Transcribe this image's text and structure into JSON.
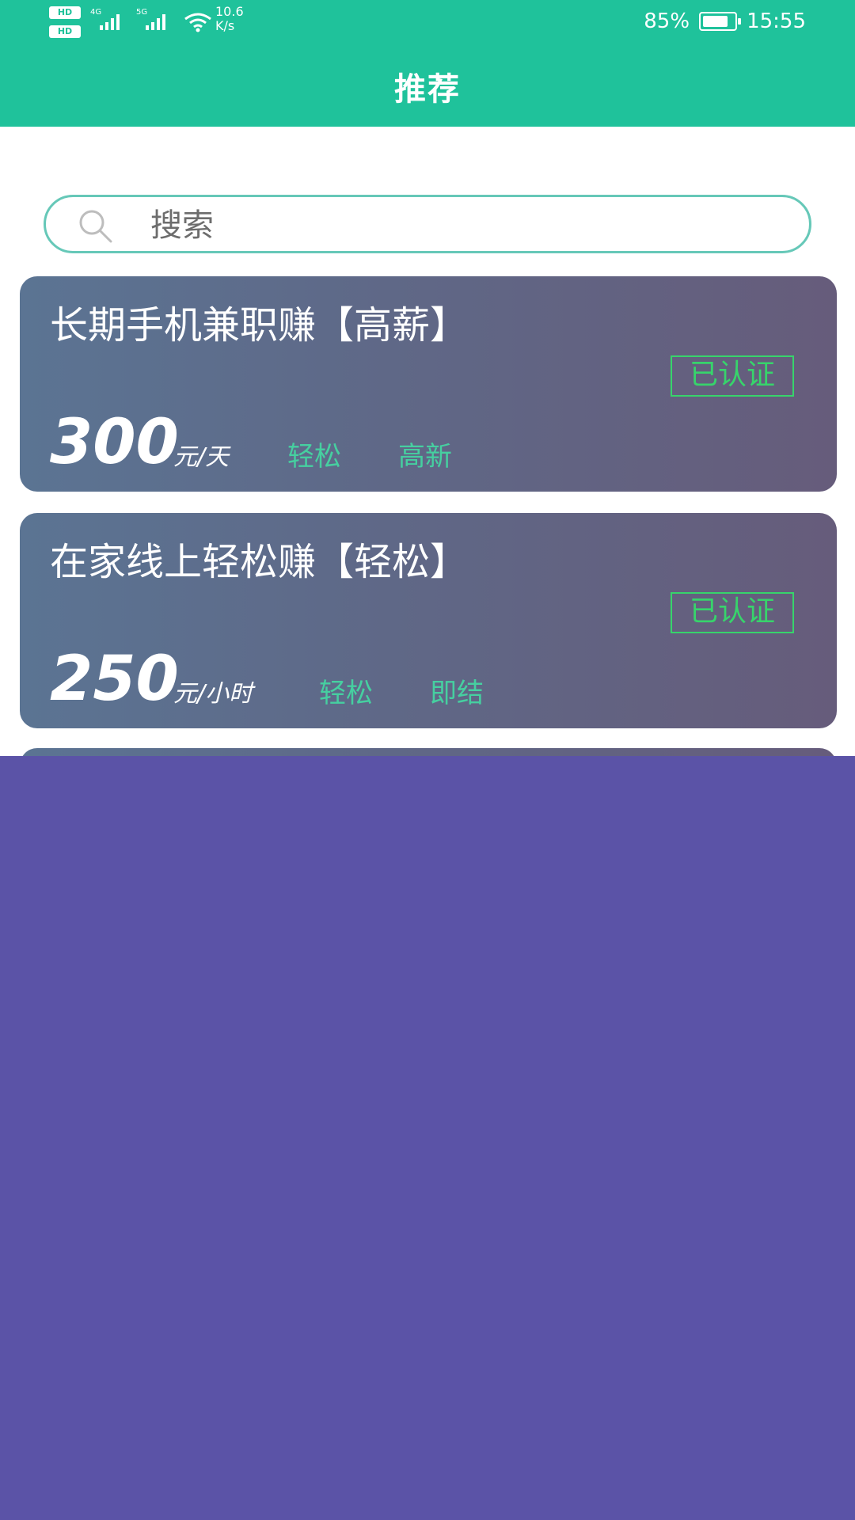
{
  "status_bar": {
    "hd_label": "HD",
    "signal_1_tag": "4G",
    "signal_2_tag": "5G",
    "net_speed_value": "10.6",
    "net_speed_unit": "K/s",
    "battery_percent": "85%",
    "battery_level": 0.85,
    "time": "15:55"
  },
  "app_bar": {
    "title": "推荐"
  },
  "search": {
    "placeholder": "搜索"
  },
  "jobs": [
    {
      "title": "长期手机兼职赚【高薪】",
      "verified_label": "已认证",
      "price": "300",
      "unit": "元/天",
      "tags": [
        "轻松",
        "高新"
      ]
    },
    {
      "title": "在家线上轻松赚【轻松】",
      "verified_label": "已认证",
      "price": "250",
      "unit": "元/小时",
      "tags": [
        "轻松",
        "即结"
      ]
    }
  ],
  "colors": {
    "primary": "#1fc29b",
    "verified": "#37d46b",
    "tag": "#46cfa0",
    "overlay": "#5b53a7",
    "card_start": "#5b7493",
    "card_end": "#665c7b"
  }
}
